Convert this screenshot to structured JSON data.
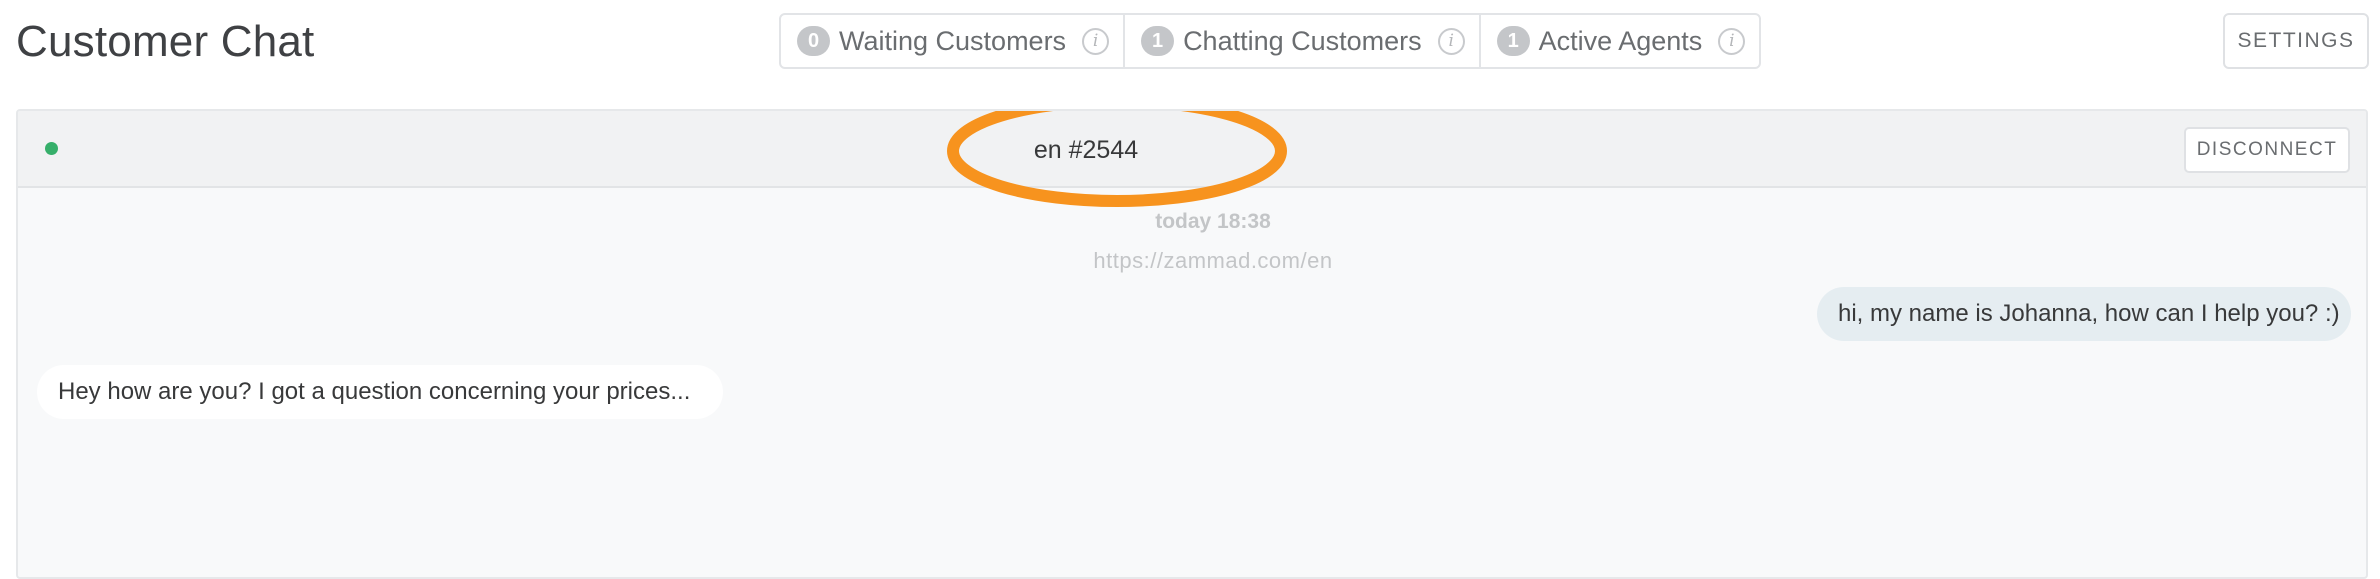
{
  "page": {
    "title": "Customer Chat"
  },
  "counters": [
    {
      "count": "0",
      "label": "Waiting Customers",
      "info_icon": "info-icon"
    },
    {
      "count": "1",
      "label": "Chatting Customers",
      "info_icon": "info-icon"
    },
    {
      "count": "1",
      "label": "Active Agents",
      "info_icon": "info-icon"
    }
  ],
  "info_glyph": "i",
  "settings": {
    "label": "SETTINGS"
  },
  "chat": {
    "status": "online",
    "status_color": "#36af6a",
    "title": "en #2544",
    "disconnect_label": "DISCONNECT",
    "timestamp": "today 18:38",
    "url": "https://zammad.com/en",
    "messages": [
      {
        "from": "agent",
        "text": "hi, my name is Johanna, how can I help you? :)"
      },
      {
        "from": "customer",
        "text": "Hey how are you? I got a question concerning your prices..."
      }
    ]
  },
  "colors": {
    "highlight": "#f7931e",
    "agent_bubble": "#e5edf1",
    "customer_bubble": "#ffffff"
  }
}
